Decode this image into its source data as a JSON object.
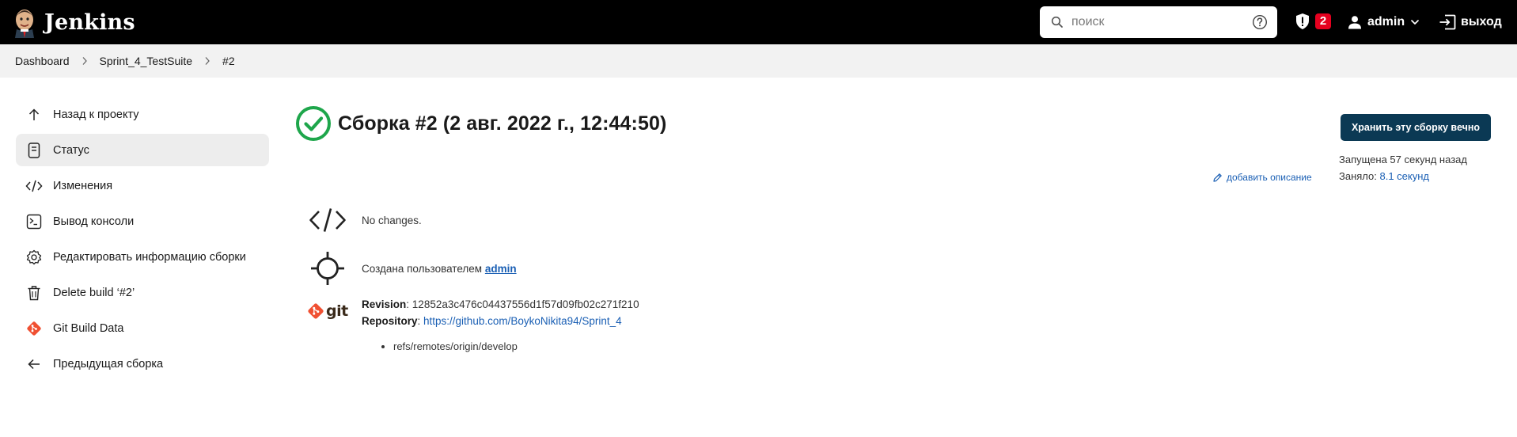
{
  "header": {
    "brand": "Jenkins",
    "search_placeholder": "поиск",
    "security_badge": "2",
    "user_name": "admin",
    "logout_label": "выход"
  },
  "breadcrumb": {
    "items": [
      "Dashboard",
      "Sprint_4_TestSuite",
      "#2"
    ]
  },
  "sidebar": {
    "items": [
      {
        "label": "Назад к проекту",
        "icon": "arrow-up-icon"
      },
      {
        "label": "Статус",
        "icon": "document-icon",
        "active": true
      },
      {
        "label": "Изменения",
        "icon": "code-icon"
      },
      {
        "label": "Вывод консоли",
        "icon": "terminal-icon"
      },
      {
        "label": "Редактировать информацию сборки",
        "icon": "gear-icon"
      },
      {
        "label": "Delete build ‘#2’",
        "icon": "trash-icon"
      },
      {
        "label": "Git Build Data",
        "icon": "git-icon"
      },
      {
        "label": "Предыдущая сборка",
        "icon": "arrow-left-icon"
      }
    ]
  },
  "build": {
    "title": "Сборка #2 (2 авг. 2022 г., 12:44:50)",
    "status_color": "#1ea64b",
    "keep_button": "Хранить эту сборку вечно",
    "started": "Запущена 57 секунд назад",
    "took_label": "Заняло:",
    "took_value": "8.1 секунд",
    "add_description": "добавить описание",
    "changes_text": "No changes.",
    "created_by_text": "Создана пользователем",
    "created_by_user": "admin",
    "revision_label": "Revision",
    "revision_value": "12852a3c476c04437556d1f57d09fb02c271f210",
    "repository_label": "Repository",
    "repository_value": "https://github.com/BoykoNikita94/Sprint_4",
    "branches": [
      "refs/remotes/origin/develop"
    ],
    "git_word": "git"
  },
  "colors": {
    "header_bg": "#000000",
    "breadcrumb_bg": "#f2f2f2",
    "accent_button": "#0b3954",
    "link": "#1a5fb4",
    "badge": "#e6001f",
    "git_orange": "#f05032"
  }
}
